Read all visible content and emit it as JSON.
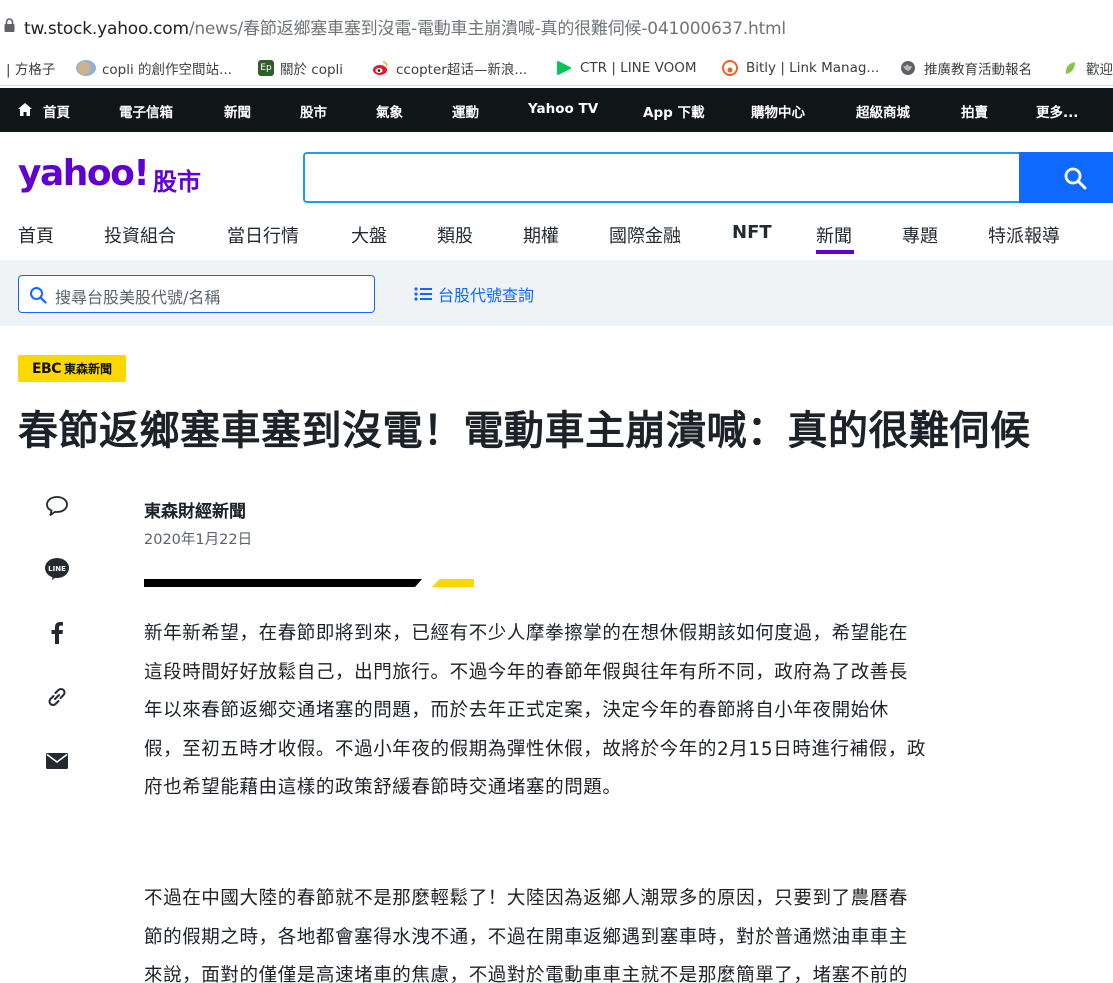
{
  "browser": {
    "url_host": "tw.stock.yahoo.com",
    "url_path": "/news/春節返鄉塞車塞到沒電-電動車主崩潰喊-真的很難伺候-041000637.html"
  },
  "bookmarks": [
    {
      "label": "| 方格子"
    },
    {
      "label": "copli 的創作空間站..."
    },
    {
      "label": "關於 copli"
    },
    {
      "label": "ccopter超话—新浪..."
    },
    {
      "label": "CTR | LINE VOOM"
    },
    {
      "label": "Bitly | Link Manag..."
    },
    {
      "label": "推廣教育活動報名"
    },
    {
      "label": "歡迎"
    }
  ],
  "topnav": {
    "items": [
      "首頁",
      "電子信箱",
      "新聞",
      "股市",
      "氣象",
      "運動",
      "Yahoo TV",
      "App 下載",
      "購物中心",
      "超級商城",
      "拍賣",
      "更多..."
    ]
  },
  "header": {
    "logo": "yahoo!",
    "logo_sub": "股市"
  },
  "catnav": {
    "items": [
      "首頁",
      "投資組合",
      "當日行情",
      "大盤",
      "類股",
      "期權",
      "國際金融",
      "NFT",
      "新聞",
      "專題",
      "特派報導"
    ]
  },
  "stock_search": {
    "placeholder": "搜尋台股美股代號/名稱",
    "code_link": "台股代號查詢"
  },
  "article": {
    "source_mark": "EBC",
    "source_label": "東森新聞",
    "title": "春節返鄉塞車塞到沒電！電動車主崩潰喊：真的很難伺候",
    "author": "東森財經新聞",
    "date": "2020年1月22日",
    "paragraph1": [
      "新年新希望，在春節即將到來，已經有不少人摩拳擦掌的在想休假期該如何度過，希望能在",
      "這段時間好好放鬆自己，出門旅行。不過今年的春節年假與往年有所不同，政府為了改善長",
      "年以來春節返鄉交通堵塞的問題，而於去年正式定案，決定今年的春節將自小年夜開始休",
      "假，至初五時才收假。不過小年夜的假期為彈性休假，故將於今年的2月15日時進行補假，政",
      "府也希望能藉由這樣的政策舒緩春節時交通堵塞的問題。"
    ],
    "paragraph2": [
      "不過在中國大陸的春節就不是那麼輕鬆了！大陸因為返鄉人潮眾多的原因，只要到了農曆春",
      "節的假期之時，各地都會塞得水洩不通，不過在開車返鄉遇到塞車時，對於普通燃油車車主",
      "來說，面對的僅僅是高速堵車的焦慮，不過對於電動車車主就不是那麼簡單了，堵塞不前的"
    ]
  },
  "colors": {
    "yahoo_purple": "#6001d2",
    "search_blue": "#0f69ff",
    "ebc_yellow": "#fcd800",
    "topnav_bg": "#101518"
  }
}
